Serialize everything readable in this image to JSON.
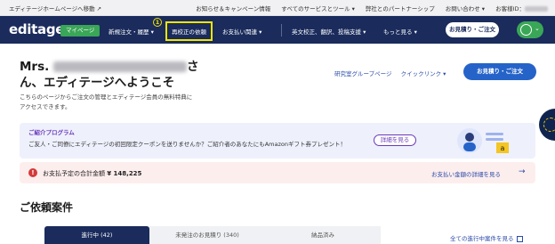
{
  "topbar": {
    "back_link": "エディテージホームページへ移動 ↗",
    "links": [
      "お知らせ＆キャンペーン情報",
      "すべてのサービスとツール ▾",
      "弊社とのパートナーシップ",
      "お問い合わせ ▾",
      "お客様ID："
    ]
  },
  "nav": {
    "logo": "editage",
    "mypage": "マイページ",
    "items": [
      "新規注文・履歴 ▾",
      "再校正の依頼",
      "お支払い関連 ▾",
      "英文校正、翻訳、投稿支援 ▾",
      "もっと見る ▾"
    ],
    "step_badge": "1",
    "quote_button": "お見積り・ご注文"
  },
  "welcome": {
    "prefix": "Mrs.",
    "name": "Test account for Translation",
    "suffix": "さ",
    "line2": "ん、エディテージへようこそ",
    "intro": "こちらのページからご注文の管理とエディテージ会員の無料特典にアクセスできます。"
  },
  "header_links": [
    "研究室グループページ",
    "クイックリンク ▾"
  ],
  "quote_button": "お見積り・ご注文",
  "referral": {
    "title": "ご紹介プログラム",
    "description": "ご友人・ご同僚にエディテージの初回限定クーポンを送りませんか？ご紹介者のあなたにもAmazonギフト券プレゼント！",
    "detail_button": "詳細を見る"
  },
  "payment": {
    "icon": "!",
    "label": "お支払予定の合計金額",
    "amount": "¥ 148,225",
    "detail_link": "お支払い金額の詳細を見る",
    "arrow": "→"
  },
  "requests": {
    "title": "ご依頼案件",
    "tabs": [
      "進行中 (42)",
      "未発注のお見積り (340)",
      "納品済み"
    ],
    "all_link": "全ての進行中案件を見る"
  },
  "colors": {
    "nav_bg": "#1a2b5c",
    "accent_green": "#3aa657",
    "highlight_yellow": "#f2e600",
    "primary_blue": "#2563c9",
    "alert_red": "#d33a3a"
  }
}
